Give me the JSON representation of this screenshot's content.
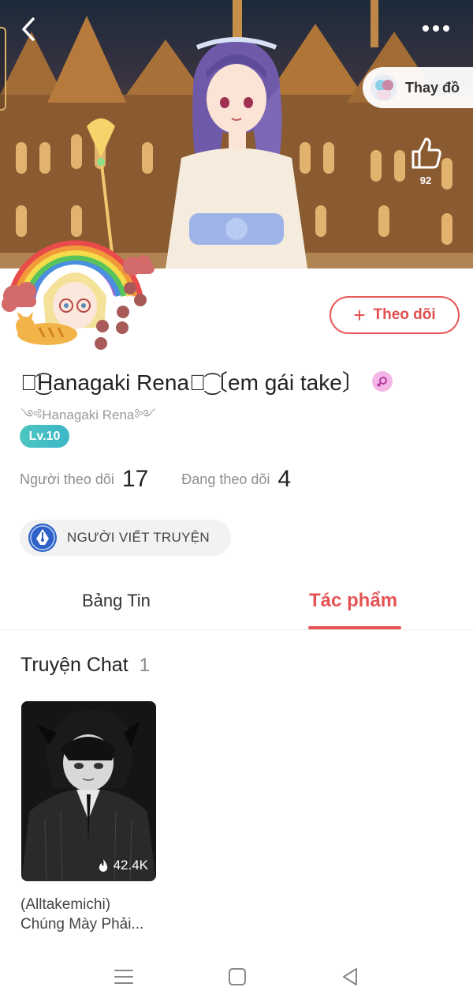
{
  "header": {
    "back_icon": "chevron-left-icon",
    "more_icon": "more-dots-icon",
    "change_outfit_label": "Thay đồ",
    "like_icon": "thumbs-up-icon",
    "like_count": "92"
  },
  "profile": {
    "follow_label": "Theo dõi",
    "display_name": "ꦿ͜͡Hanagaki Renaꦿ͜͡〔em gái take〕",
    "sub_name": "༺Hanagaki Rena༻",
    "gender_icon": "female-symbol-icon",
    "level": "Lv.10",
    "followers_label": "Người theo dõi",
    "followers_count": "17",
    "following_label": "Đang theo dõi",
    "following_count": "4",
    "badge_label": "NGƯỜI VIẾT TRUYỆN",
    "badge_icon": "pen-nib-icon"
  },
  "tabs": [
    {
      "label": "Bảng Tin",
      "active": false
    },
    {
      "label": "Tác phẩm",
      "active": true
    }
  ],
  "section": {
    "title": "Truyện Chat",
    "count": "1"
  },
  "stories": [
    {
      "views": "42.4K",
      "title_line1": "(Alltakemichi)",
      "title_line2": "Chúng Mày Phải..."
    }
  ],
  "colors": {
    "accent": "#e55454",
    "level_badge": "#3fbcc4",
    "gender_badge": "#f3b6e6"
  }
}
